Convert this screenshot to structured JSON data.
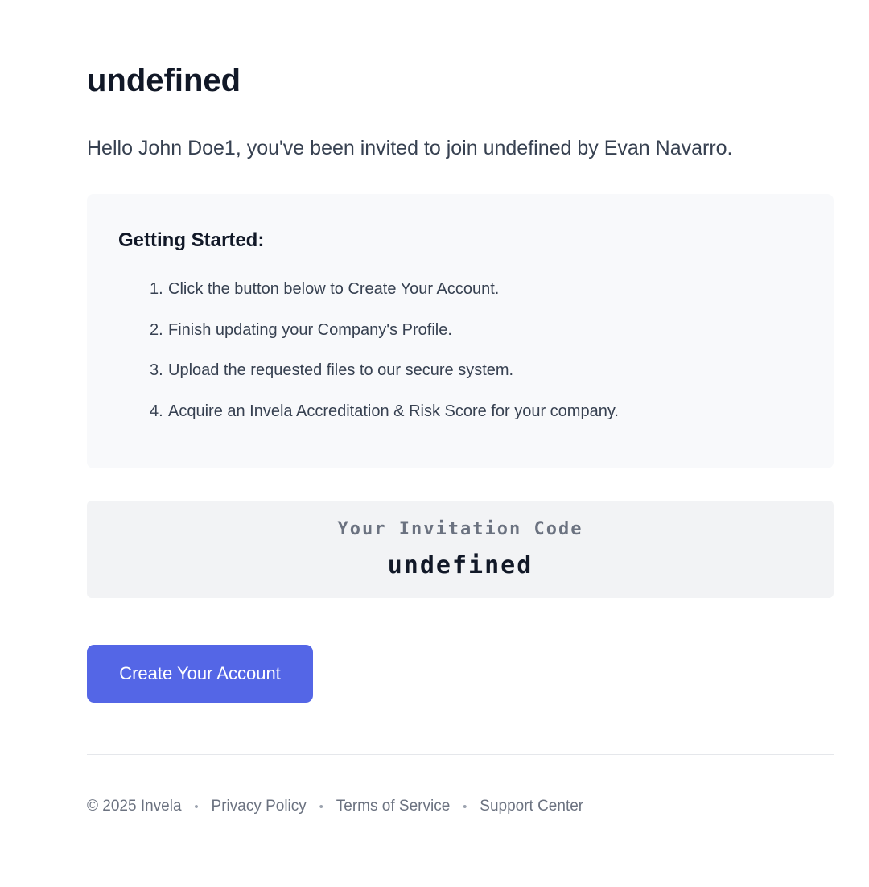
{
  "email": {
    "title": "undefined",
    "greeting": "Hello John Doe1, you've been invited to join undefined by Evan Navarro."
  },
  "getting_started": {
    "heading": "Getting Started:",
    "steps": [
      {
        "number": "1.",
        "text": "Click the button below to Create Your Account."
      },
      {
        "number": "2.",
        "text": "Finish updating your Company's Profile."
      },
      {
        "number": "3.",
        "text": "Upload the requested files to our secure system."
      },
      {
        "number": "4.",
        "text": "Acquire an Invela Accreditation & Risk Score for your company."
      }
    ]
  },
  "invitation": {
    "label": "Your Invitation Code",
    "code": "undefined"
  },
  "cta": {
    "label": "Create Your Account"
  },
  "footer": {
    "copyright": "© 2025 Invela",
    "separator": "•",
    "links": [
      {
        "label": "Privacy Policy"
      },
      {
        "label": "Terms of Service"
      },
      {
        "label": "Support Center"
      }
    ]
  },
  "colors": {
    "accent": "#5466e6",
    "heading": "#111827",
    "body_text": "#374151",
    "muted_text": "#6b7280",
    "panel_background": "#f8f9fb",
    "code_background": "#f2f3f5"
  }
}
